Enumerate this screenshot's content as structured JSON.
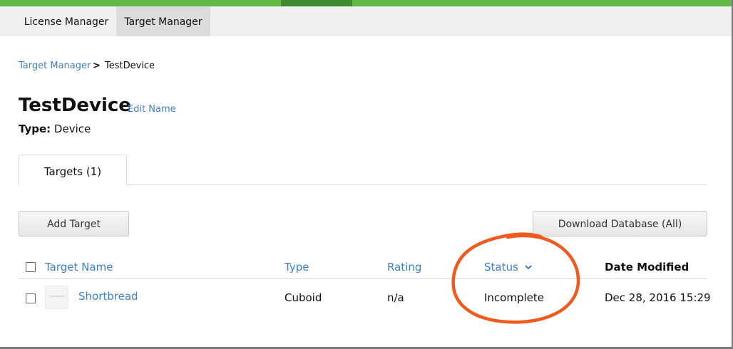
{
  "nav": {
    "tabs": [
      {
        "label": "License Manager"
      },
      {
        "label": "Target Manager"
      }
    ]
  },
  "breadcrumb": {
    "root": "Target Manager",
    "separator": ">",
    "current": "TestDevice"
  },
  "header": {
    "title": "TestDevice",
    "edit_label": "Edit Name",
    "type_label": "Type:",
    "type_value": "Device"
  },
  "tabs": {
    "targets_label": "Targets (1)"
  },
  "toolbar": {
    "add_label": "Add Target",
    "download_label": "Download Database (All)"
  },
  "table": {
    "columns": {
      "name": "Target Name",
      "type": "Type",
      "rating": "Rating",
      "status": "Status",
      "date": "Date Modified"
    },
    "rows": [
      {
        "name": "Shortbread",
        "type": "Cuboid",
        "rating": "n/a",
        "status": "Incomplete",
        "date": "Dec 28, 2016 15:29"
      }
    ]
  },
  "colors": {
    "brand_green": "#64b944",
    "link_blue": "#3f7fc6",
    "annotation_orange": "#f05a1e"
  },
  "icons": {
    "sort": "chevron-down-icon"
  }
}
